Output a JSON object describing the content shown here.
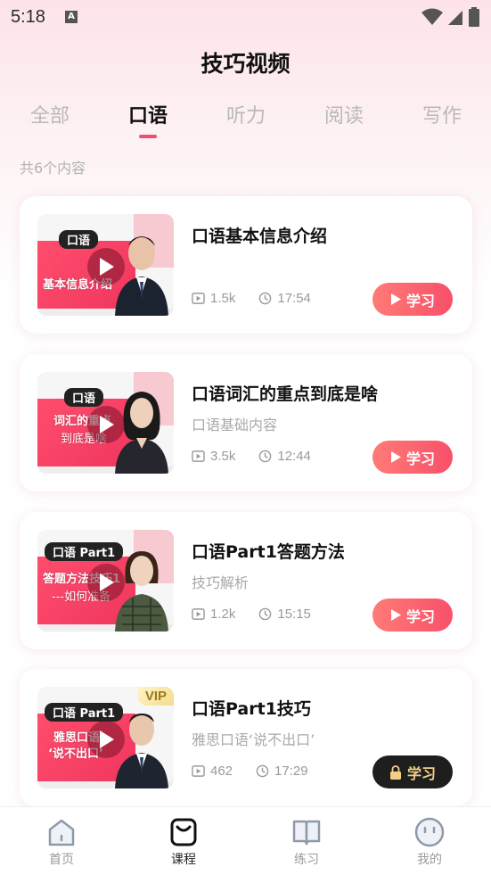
{
  "status_bar": {
    "time": "5:18",
    "a_badge": "A"
  },
  "header": {
    "title": "技巧视频"
  },
  "tabs": [
    {
      "label": "全部",
      "active": false
    },
    {
      "label": "口语",
      "active": true
    },
    {
      "label": "听力",
      "active": false
    },
    {
      "label": "阅读",
      "active": false
    },
    {
      "label": "写作",
      "active": false
    }
  ],
  "content_count": "共6个内容",
  "cards": [
    {
      "thumb_badge": "口语",
      "thumb_lines": [
        "基本信息介绍"
      ],
      "title": "口语基本信息介绍",
      "subtitle": "",
      "views": "1.5k",
      "duration": "17:54",
      "button": "学习",
      "locked": false,
      "vip": ""
    },
    {
      "thumb_badge": "口语",
      "thumb_lines": [
        "词汇的重点",
        "到底是啥"
      ],
      "title": "口语词汇的重点到底是啥",
      "subtitle": "口语基础内容",
      "views": "3.5k",
      "duration": "12:44",
      "button": "学习",
      "locked": false,
      "vip": ""
    },
    {
      "thumb_badge": "口语 Part1",
      "thumb_lines": [
        "答题方法技巧1",
        "---如何准备"
      ],
      "title": "口语Part1答题方法",
      "subtitle": "技巧解析",
      "views": "1.2k",
      "duration": "15:15",
      "button": "学习",
      "locked": false,
      "vip": ""
    },
    {
      "thumb_badge": "口语 Part1",
      "thumb_lines": [
        "雅思口语",
        "‘说不出口’"
      ],
      "title": "口语Part1技巧",
      "subtitle": "雅思口语‘说不出口’",
      "views": "462",
      "duration": "17:29",
      "button": "学习",
      "locked": true,
      "vip": "VIP"
    }
  ],
  "bottom_nav": [
    {
      "label": "首页",
      "icon": "home-icon",
      "active": false
    },
    {
      "label": "课程",
      "icon": "course-icon",
      "active": true
    },
    {
      "label": "练习",
      "icon": "book-icon",
      "active": false
    },
    {
      "label": "我的",
      "icon": "profile-icon",
      "active": false
    }
  ],
  "colors": {
    "accent": "#f0506e",
    "button_gradient_start": "#ff7b76",
    "button_gradient_end": "#f8506a",
    "locked_button": "#1e1e1e",
    "locked_text": "#f1cf86"
  }
}
